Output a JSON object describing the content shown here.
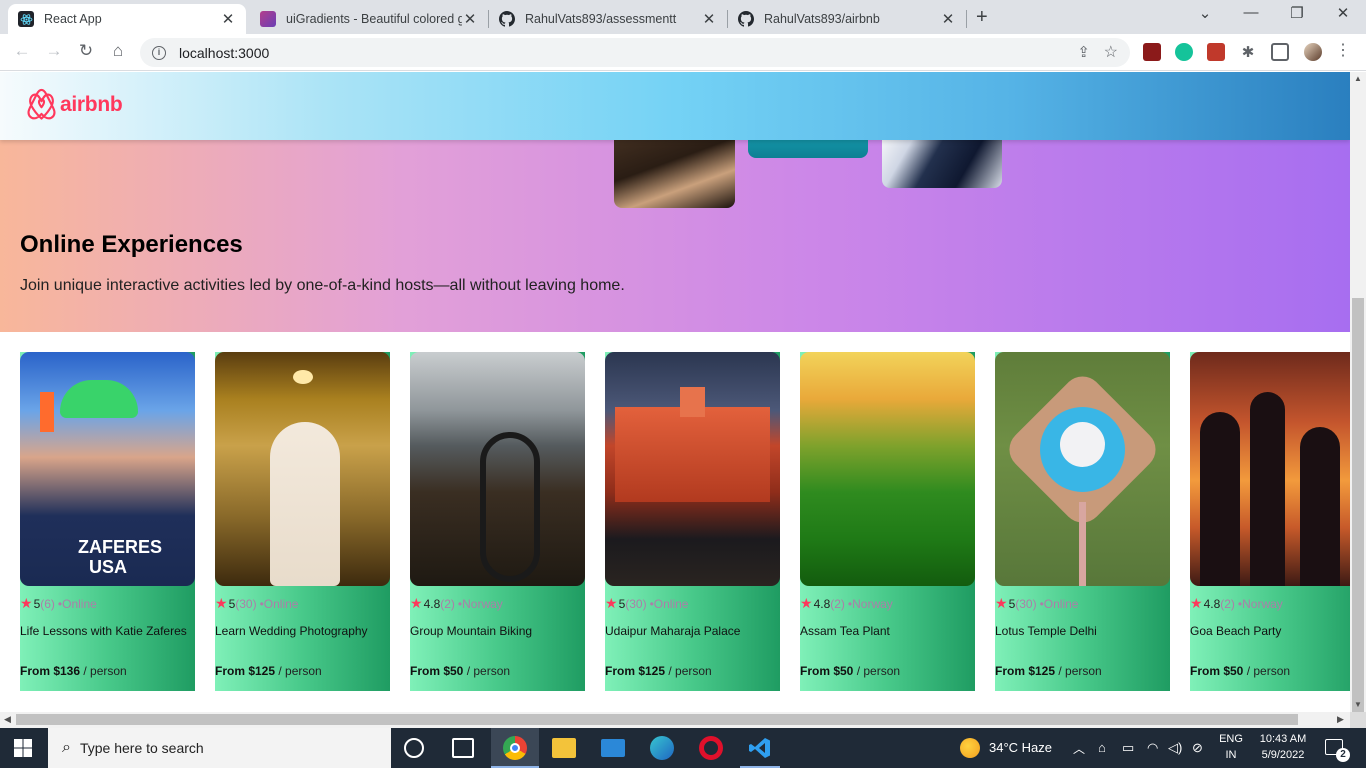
{
  "browser": {
    "tabs": [
      {
        "title": "React App",
        "favicon": "react-icon",
        "active": true
      },
      {
        "title": "uiGradients - Beautiful colored gr",
        "favicon": "uigradients-icon",
        "active": false
      },
      {
        "title": "RahulVats893/assessmentt",
        "favicon": "github-icon",
        "active": false
      },
      {
        "title": "RahulVats893/airbnb",
        "favicon": "github-icon",
        "active": false
      }
    ],
    "url": "localhost:3000"
  },
  "page": {
    "logo_text": "airbnb",
    "hero": {
      "title": "Online Experiences",
      "subtitle": "Join unique interactive activities led by one-of-a-kind hosts—all without leaving home."
    },
    "cards": [
      {
        "rating": "5",
        "count": "(6)",
        "separator": "•",
        "location": "Online",
        "title": "Life Lessons with Katie Zaferes",
        "price": "From $136",
        "per": " / person",
        "image": "swimmer-photo"
      },
      {
        "rating": "5",
        "count": "(30)",
        "separator": "•",
        "location": "Online",
        "title": "Learn Wedding Photography",
        "price": "From $125",
        "per": " / person",
        "image": "bride-photo"
      },
      {
        "rating": "4.8",
        "count": "(2)",
        "separator": "•",
        "location": "Norway",
        "title": "Group Mountain Biking",
        "price": "From $50",
        "per": " / person",
        "image": "mountain-bike-photo"
      },
      {
        "rating": "5",
        "count": "(30)",
        "separator": "•",
        "location": "Online",
        "title": "Udaipur Maharaja Palace",
        "price": "From $125",
        "per": " / person",
        "image": "palace-photo"
      },
      {
        "rating": "4.8",
        "count": "(2)",
        "separator": "•",
        "location": "Norway",
        "title": "Assam Tea Plant",
        "price": "From $50",
        "per": " / person",
        "image": "tea-plantation-photo"
      },
      {
        "rating": "5",
        "count": "(30)",
        "separator": "•",
        "location": "Online",
        "title": "Lotus Temple Delhi",
        "price": "From $125",
        "per": " / person",
        "image": "lotus-temple-photo"
      },
      {
        "rating": "4.8",
        "count": "(2)",
        "separator": "•",
        "location": "Norway",
        "title": "Goa Beach Party",
        "price": "From $50",
        "per": " / person",
        "image": "beach-party-photo"
      }
    ]
  },
  "taskbar": {
    "search_placeholder": "Type here to search",
    "weather": "34°C  Haze",
    "lang_top": "ENG",
    "lang_bottom": "IN",
    "time": "10:43 AM",
    "date": "5/9/2022",
    "notification_count": "2"
  },
  "colors": {
    "brand": "#ff385c",
    "card_gradient": [
      "#7ff0b8",
      "#1f9c62"
    ],
    "hero_gradient": [
      "#f8b79a",
      "#a76ef0"
    ],
    "navbar_gradient": [
      "#f6fbfd",
      "#2a7fbf"
    ]
  }
}
